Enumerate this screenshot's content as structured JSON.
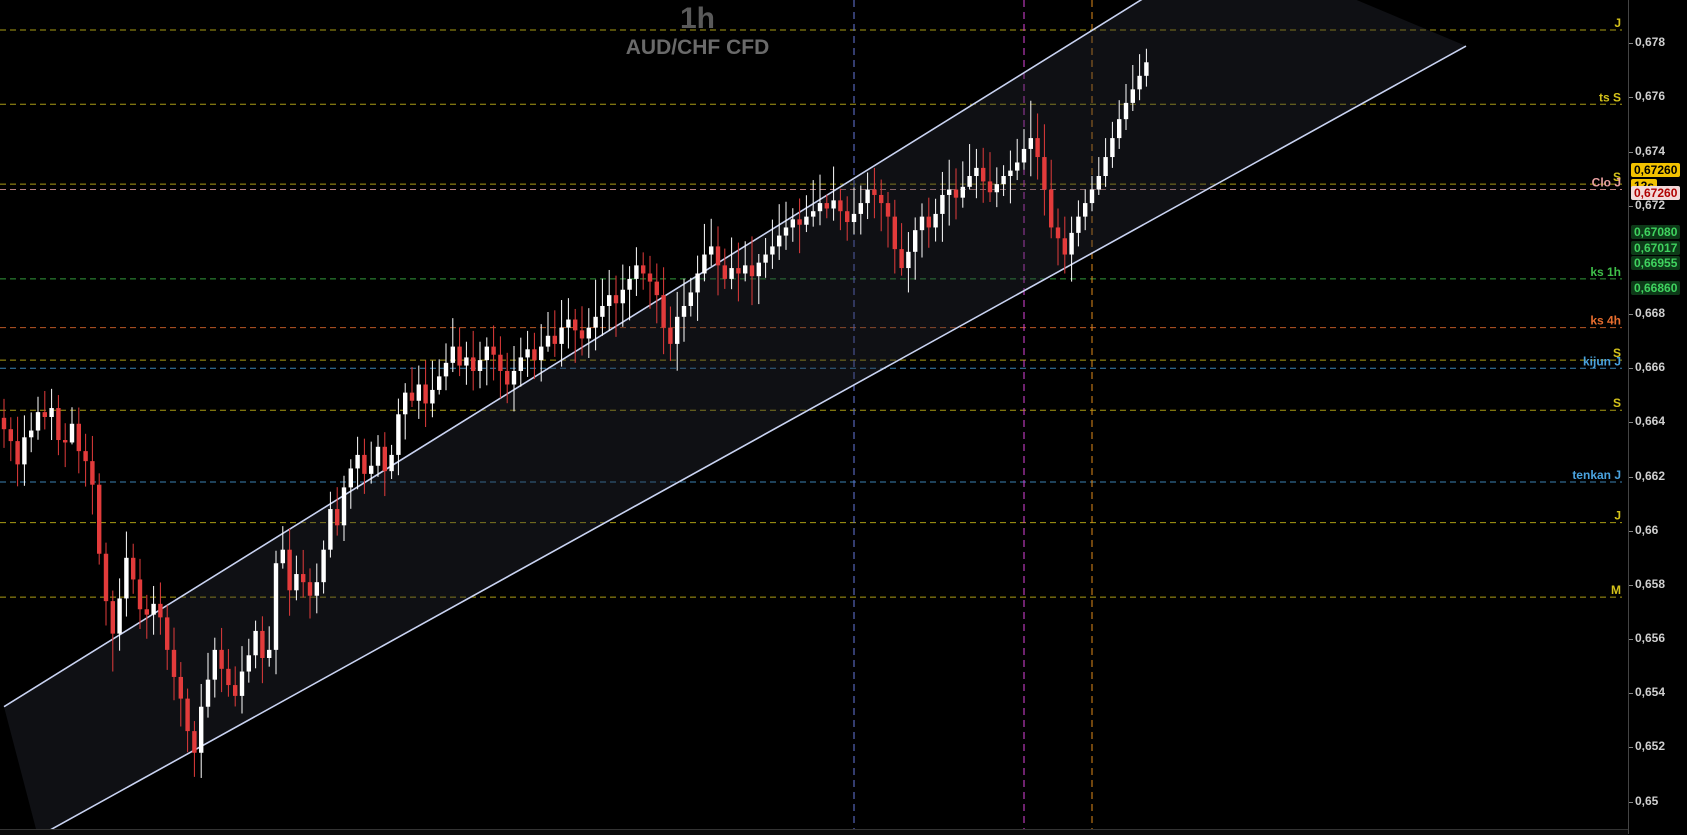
{
  "header": {
    "timeframe": "1h",
    "symbol": "AUD/CHF CFD"
  },
  "price_axis": {
    "ticks": [
      "0,678",
      "0,676",
      "0,674",
      "0,672",
      "0,668",
      "0,666",
      "0,664",
      "0,662",
      "0,66",
      "0,658",
      "0,656",
      "0,654",
      "0,652",
      "0,65"
    ],
    "badges": [
      {
        "text": "0,67260",
        "bg": "#f2c200",
        "fg": "#000000",
        "price": 0.6726
      },
      {
        "text": "12s",
        "bg": "#f2c200",
        "fg": "#000000",
        "price": 0.672
      },
      {
        "text": "0,67260",
        "bg": "#f2d9d9",
        "fg": "#b00000",
        "price": 0.672
      },
      {
        "text": "0,67080",
        "bg": "#0d3a18",
        "fg": "#3fd35f",
        "price": 0.6708
      },
      {
        "text": "0,67017",
        "bg": "#0d3a18",
        "fg": "#3fd35f",
        "price": 0.67017
      },
      {
        "text": "0,66955",
        "bg": "#0d3a18",
        "fg": "#3fd35f",
        "price": 0.66955
      },
      {
        "text": "0,66860",
        "bg": "#0d3a18",
        "fg": "#3fd35f",
        "price": 0.6686
      }
    ]
  },
  "chart_data": {
    "type": "candlestick",
    "ylim": [
      0.6488,
      0.6796
    ],
    "levels": [
      {
        "label": "J",
        "price": 0.67849,
        "color": "#d4c21a"
      },
      {
        "label": "ts S",
        "price": 0.67575,
        "color": "#d4c21a"
      },
      {
        "label": "S",
        "price": 0.6728,
        "color": "#d4c21a"
      },
      {
        "label": "Clo J",
        "price": 0.6726,
        "color": "#e8a0a0"
      },
      {
        "label": "ks 1h",
        "price": 0.6693,
        "color": "#3fc04a"
      },
      {
        "label": "ks 4h",
        "price": 0.6675,
        "color": "#e86d2e"
      },
      {
        "label": "S",
        "price": 0.6663,
        "color": "#d4c21a"
      },
      {
        "label": "kijun J",
        "price": 0.666,
        "color": "#4aa3df"
      },
      {
        "label": "S",
        "price": 0.66445,
        "color": "#d4c21a"
      },
      {
        "label": "tenkan J",
        "price": 0.6618,
        "color": "#4aa3df"
      },
      {
        "label": "J",
        "price": 0.6603,
        "color": "#d4c21a"
      },
      {
        "label": "M",
        "price": 0.65755,
        "color": "#d4c21a"
      }
    ],
    "session_lines": [
      {
        "bar": 125,
        "color": "#6677dd"
      },
      {
        "bar": 150,
        "color": "#dd44dd"
      },
      {
        "bar": 160,
        "color": "#e08a1a"
      }
    ],
    "channel": {
      "upper": [
        [
          0,
          0.6535
        ],
        [
          180,
          0.6816
        ]
      ],
      "lower": [
        [
          5,
          0.6487
        ],
        [
          215,
          0.6779
        ]
      ]
    },
    "candles": [
      [
        0.66417,
        0.66375,
        0.66487,
        0.66306
      ],
      [
        0.66375,
        0.66331,
        0.66419,
        0.66257
      ],
      [
        0.66331,
        0.66245,
        0.66421,
        0.66164
      ],
      [
        0.66245,
        0.66345,
        0.66426,
        0.66166
      ],
      [
        0.66345,
        0.6637,
        0.66437,
        0.6629
      ],
      [
        0.6637,
        0.66438,
        0.66495,
        0.66336
      ],
      [
        0.66438,
        0.6642,
        0.66516,
        0.66374
      ],
      [
        0.6642,
        0.66453,
        0.66524,
        0.66335
      ],
      [
        0.66453,
        0.66335,
        0.66501,
        0.66279
      ],
      [
        0.66335,
        0.66326,
        0.66397,
        0.66235
      ],
      [
        0.66326,
        0.66395,
        0.66456,
        0.66319
      ],
      [
        0.66395,
        0.66294,
        0.66455,
        0.66212
      ],
      [
        0.66294,
        0.66257,
        0.66358,
        0.66163
      ],
      [
        0.66257,
        0.6617,
        0.6635,
        0.6606
      ],
      [
        0.6617,
        0.65915,
        0.66212,
        0.65875
      ],
      [
        0.65915,
        0.6574,
        0.65956,
        0.6565
      ],
      [
        0.6574,
        0.6562,
        0.65779,
        0.6548
      ],
      [
        0.6562,
        0.6575,
        0.65824,
        0.65557
      ],
      [
        0.6575,
        0.659,
        0.65997,
        0.65683
      ],
      [
        0.659,
        0.6582,
        0.65952,
        0.65767
      ],
      [
        0.6582,
        0.6571,
        0.65896,
        0.65637
      ],
      [
        0.6571,
        0.6569,
        0.65763,
        0.65601
      ],
      [
        0.6569,
        0.6573,
        0.65796,
        0.65616
      ],
      [
        0.6573,
        0.6568,
        0.65809,
        0.65616
      ],
      [
        0.6568,
        0.6556,
        0.65725,
        0.65486
      ],
      [
        0.6556,
        0.6546,
        0.65642,
        0.65374
      ],
      [
        0.6546,
        0.6538,
        0.65515,
        0.65277
      ],
      [
        0.6538,
        0.6526,
        0.65417,
        0.65182
      ],
      [
        0.6526,
        0.6518,
        0.65297,
        0.65091
      ],
      [
        0.6518,
        0.6535,
        0.65434,
        0.65087
      ],
      [
        0.6535,
        0.6545,
        0.65549,
        0.6531
      ],
      [
        0.6545,
        0.6556,
        0.65605,
        0.65384
      ],
      [
        0.6556,
        0.6549,
        0.65641,
        0.65404
      ],
      [
        0.6549,
        0.6543,
        0.65563,
        0.65387
      ],
      [
        0.6543,
        0.6539,
        0.65499,
        0.65351
      ],
      [
        0.6539,
        0.6548,
        0.65574,
        0.65325
      ],
      [
        0.6548,
        0.6554,
        0.65601,
        0.65439
      ],
      [
        0.6554,
        0.6563,
        0.65668,
        0.65492
      ],
      [
        0.6563,
        0.6553,
        0.65684,
        0.65437
      ],
      [
        0.6553,
        0.6556,
        0.65647,
        0.65498
      ],
      [
        0.6556,
        0.6588,
        0.65926,
        0.6547
      ],
      [
        0.6588,
        0.6593,
        0.66017,
        0.6586
      ],
      [
        0.6593,
        0.6578,
        0.66007,
        0.65686
      ],
      [
        0.6578,
        0.6584,
        0.65908,
        0.65743
      ],
      [
        0.6584,
        0.6581,
        0.65929,
        0.65753
      ],
      [
        0.6581,
        0.6576,
        0.65861,
        0.65676
      ],
      [
        0.6576,
        0.6581,
        0.65879,
        0.65695
      ],
      [
        0.6581,
        0.6593,
        0.65964,
        0.65768
      ],
      [
        0.6593,
        0.6608,
        0.66144,
        0.65901
      ],
      [
        0.6608,
        0.6602,
        0.66161,
        0.65982
      ],
      [
        0.6602,
        0.6616,
        0.66203,
        0.65962
      ],
      [
        0.6616,
        0.6623,
        0.66264,
        0.66081
      ],
      [
        0.6623,
        0.6628,
        0.66347,
        0.66153
      ],
      [
        0.6628,
        0.6621,
        0.6634,
        0.66136
      ],
      [
        0.6621,
        0.6624,
        0.66329,
        0.66174
      ],
      [
        0.6624,
        0.6631,
        0.66353,
        0.66199
      ],
      [
        0.6631,
        0.6622,
        0.66364,
        0.66128
      ],
      [
        0.6622,
        0.6628,
        0.66317,
        0.66191
      ],
      [
        0.6628,
        0.6643,
        0.66488,
        0.66205
      ],
      [
        0.6643,
        0.6651,
        0.66545,
        0.66337
      ],
      [
        0.6651,
        0.6648,
        0.66604,
        0.66457
      ],
      [
        0.6648,
        0.6654,
        0.6661,
        0.66413
      ],
      [
        0.6654,
        0.6647,
        0.66629,
        0.66383
      ],
      [
        0.6647,
        0.6652,
        0.66628,
        0.66419
      ],
      [
        0.6652,
        0.6657,
        0.66633,
        0.66503
      ],
      [
        0.6657,
        0.6662,
        0.66692,
        0.66519
      ],
      [
        0.6662,
        0.6668,
        0.66785,
        0.66586
      ],
      [
        0.6668,
        0.6661,
        0.66751,
        0.66571
      ],
      [
        0.6661,
        0.6664,
        0.66698,
        0.66539
      ],
      [
        0.6664,
        0.6659,
        0.66738,
        0.66518
      ],
      [
        0.6659,
        0.6663,
        0.66698,
        0.66526
      ],
      [
        0.6663,
        0.6668,
        0.66714,
        0.66537
      ],
      [
        0.6668,
        0.6665,
        0.66758,
        0.66555
      ],
      [
        0.6665,
        0.6659,
        0.66718,
        0.66489
      ],
      [
        0.6659,
        0.6654,
        0.66657,
        0.66471
      ],
      [
        0.6654,
        0.6659,
        0.66682,
        0.66441
      ],
      [
        0.6659,
        0.6664,
        0.66713,
        0.66532
      ],
      [
        0.6664,
        0.6667,
        0.66738,
        0.66568
      ],
      [
        0.6667,
        0.6663,
        0.66731,
        0.6656
      ],
      [
        0.6663,
        0.6668,
        0.66763,
        0.66551
      ],
      [
        0.6668,
        0.6672,
        0.66808,
        0.66661
      ],
      [
        0.6672,
        0.6669,
        0.66814,
        0.66642
      ],
      [
        0.6669,
        0.6675,
        0.66852,
        0.66606
      ],
      [
        0.6675,
        0.6678,
        0.66859,
        0.66673
      ],
      [
        0.6678,
        0.6674,
        0.66819,
        0.6662
      ],
      [
        0.6674,
        0.6671,
        0.66829,
        0.66647
      ],
      [
        0.6671,
        0.6675,
        0.66822,
        0.66638
      ],
      [
        0.6675,
        0.6679,
        0.66927,
        0.66666
      ],
      [
        0.6679,
        0.6683,
        0.66931,
        0.6672
      ],
      [
        0.6683,
        0.6687,
        0.66963,
        0.66738
      ],
      [
        0.6687,
        0.6684,
        0.66942,
        0.66716
      ],
      [
        0.6684,
        0.6689,
        0.66983,
        0.66753
      ],
      [
        0.6689,
        0.6693,
        0.66977,
        0.66777
      ],
      [
        0.6693,
        0.6698,
        0.67047,
        0.66867
      ],
      [
        0.6698,
        0.6695,
        0.67028,
        0.6689
      ],
      [
        0.6695,
        0.6692,
        0.67015,
        0.6682
      ],
      [
        0.6692,
        0.6687,
        0.66987,
        0.66766
      ],
      [
        0.6687,
        0.6675,
        0.66973,
        0.66652
      ],
      [
        0.6675,
        0.6669,
        0.66828,
        0.66627
      ],
      [
        0.6669,
        0.6679,
        0.66882,
        0.66591
      ],
      [
        0.6679,
        0.6683,
        0.66931,
        0.66698
      ],
      [
        0.6683,
        0.6688,
        0.66934,
        0.66791
      ],
      [
        0.6688,
        0.6695,
        0.67016,
        0.66775
      ],
      [
        0.6695,
        0.6702,
        0.67133,
        0.66921
      ],
      [
        0.6702,
        0.6705,
        0.67152,
        0.66978
      ],
      [
        0.6705,
        0.6698,
        0.67124,
        0.66869
      ],
      [
        0.6698,
        0.6693,
        0.67042,
        0.66893
      ],
      [
        0.6693,
        0.6697,
        0.67083,
        0.66892
      ],
      [
        0.6697,
        0.6695,
        0.67064,
        0.66847
      ],
      [
        0.6695,
        0.6698,
        0.67069,
        0.66921
      ],
      [
        0.6698,
        0.6694,
        0.67087,
        0.66833
      ],
      [
        0.6694,
        0.6699,
        0.67022,
        0.66837
      ],
      [
        0.6699,
        0.6702,
        0.67081,
        0.66934
      ],
      [
        0.6702,
        0.6705,
        0.67149,
        0.66967
      ],
      [
        0.6705,
        0.6709,
        0.67206,
        0.67
      ],
      [
        0.6709,
        0.6712,
        0.67215,
        0.67037
      ],
      [
        0.6712,
        0.6715,
        0.67191,
        0.67067
      ],
      [
        0.6715,
        0.6713,
        0.67227,
        0.67025
      ],
      [
        0.6713,
        0.6716,
        0.67239,
        0.67103
      ],
      [
        0.6716,
        0.6718,
        0.67295,
        0.67123
      ],
      [
        0.6718,
        0.6721,
        0.67315,
        0.67128
      ],
      [
        0.6721,
        0.6719,
        0.67241,
        0.67154
      ],
      [
        0.6719,
        0.6722,
        0.67345,
        0.67145
      ],
      [
        0.6722,
        0.6718,
        0.67263,
        0.6711
      ],
      [
        0.6718,
        0.6714,
        0.67235,
        0.67071
      ],
      [
        0.6714,
        0.6717,
        0.67268,
        0.67095
      ],
      [
        0.6717,
        0.6721,
        0.67275,
        0.67094
      ],
      [
        0.6721,
        0.6726,
        0.67323,
        0.67151
      ],
      [
        0.6726,
        0.6724,
        0.6734,
        0.67154
      ],
      [
        0.6724,
        0.6721,
        0.67297,
        0.67106
      ],
      [
        0.6721,
        0.6716,
        0.67251,
        0.67046
      ],
      [
        0.6716,
        0.6704,
        0.67222,
        0.6695
      ],
      [
        0.6704,
        0.6697,
        0.67136,
        0.66942
      ],
      [
        0.6697,
        0.6703,
        0.67103,
        0.6688
      ],
      [
        0.6703,
        0.6711,
        0.67157,
        0.66927
      ],
      [
        0.6711,
        0.6716,
        0.67209,
        0.67009
      ],
      [
        0.6716,
        0.6712,
        0.6723,
        0.67045
      ],
      [
        0.6712,
        0.6717,
        0.67226,
        0.67068
      ],
      [
        0.6717,
        0.6724,
        0.67325,
        0.67067
      ],
      [
        0.6724,
        0.6726,
        0.6737,
        0.67127
      ],
      [
        0.6726,
        0.6723,
        0.67338,
        0.6715
      ],
      [
        0.6723,
        0.6727,
        0.67364,
        0.67193
      ],
      [
        0.6727,
        0.6731,
        0.67428,
        0.6726
      ],
      [
        0.6731,
        0.6734,
        0.6741,
        0.67228
      ],
      [
        0.6734,
        0.6729,
        0.67414,
        0.67211
      ],
      [
        0.6729,
        0.6725,
        0.67398,
        0.67214
      ],
      [
        0.6725,
        0.6728,
        0.67342,
        0.67195
      ],
      [
        0.6728,
        0.6731,
        0.6735,
        0.67236
      ],
      [
        0.6731,
        0.6733,
        0.67404,
        0.67209
      ],
      [
        0.6733,
        0.6736,
        0.67447,
        0.67295
      ],
      [
        0.6736,
        0.6741,
        0.67483,
        0.67333
      ],
      [
        0.6741,
        0.6745,
        0.67588,
        0.67309
      ],
      [
        0.6745,
        0.6738,
        0.67541,
        0.67297
      ],
      [
        0.6738,
        0.6726,
        0.67501,
        0.67164
      ],
      [
        0.6726,
        0.6712,
        0.6737,
        0.6708
      ],
      [
        0.6712,
        0.6708,
        0.6719,
        0.6698
      ],
      [
        0.6708,
        0.6702,
        0.6716,
        0.6695
      ],
      [
        0.6702,
        0.671,
        0.6716,
        0.6692
      ],
      [
        0.671,
        0.6716,
        0.6722,
        0.6705
      ],
      [
        0.6716,
        0.6721,
        0.6726,
        0.6711
      ],
      [
        0.6721,
        0.6726,
        0.6731,
        0.6718
      ],
      [
        0.6726,
        0.6731,
        0.6738,
        0.6724
      ],
      [
        0.6731,
        0.6738,
        0.6745,
        0.6727
      ],
      [
        0.6738,
        0.6745,
        0.6751,
        0.6734
      ],
      [
        0.6745,
        0.6752,
        0.6759,
        0.6741
      ],
      [
        0.6752,
        0.6758,
        0.6765,
        0.6748
      ],
      [
        0.6758,
        0.6763,
        0.6772,
        0.6755
      ],
      [
        0.6763,
        0.6768,
        0.6776,
        0.6759
      ],
      [
        0.6768,
        0.6773,
        0.6778,
        0.6764
      ]
    ]
  }
}
